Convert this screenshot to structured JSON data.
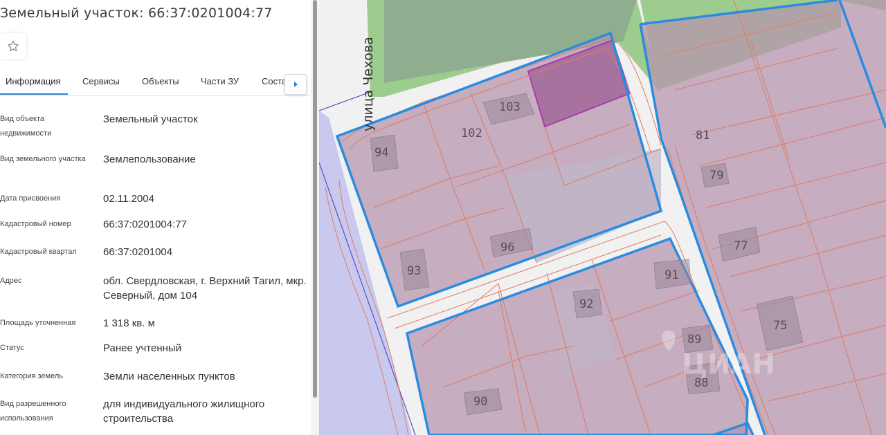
{
  "panel": {
    "title": "Земельный участок: 66:37:0201004:77",
    "tabs": [
      "Информация",
      "Сервисы",
      "Объекты",
      "Части ЗУ",
      "Соста"
    ],
    "active_tab": "Информация",
    "fields": [
      {
        "label": "Вид объекта недвижимости",
        "value": "Земельный участок"
      },
      {
        "label": "Вид земельного участка",
        "value": "Землепользование"
      },
      {
        "label": "Дата присвоения",
        "value": "02.11.2004"
      },
      {
        "label": "Кадастровый номер",
        "value": "66:37:0201004:77"
      },
      {
        "label": "Кадастровый квартал",
        "value": "66:37:0201004"
      },
      {
        "label": "Адрес",
        "value": "обл. Свердловская, г. Верхний Тагил, мкр. Северный, дом 104"
      },
      {
        "label": "Площадь уточненная",
        "value": "1 318 кв. м"
      },
      {
        "label": "Статус",
        "value": "Ранее учтенный"
      },
      {
        "label": "Категория земель",
        "value": "Земли населенных пунктов"
      },
      {
        "label": "Вид разрешенного использования",
        "value": "для индивидуального жилищного строительства"
      }
    ]
  },
  "map": {
    "street_label": "улица Чехова",
    "parcel_numbers": [
      "103",
      "102",
      "94",
      "96",
      "93",
      "81",
      "79",
      "77",
      "75",
      "91",
      "92",
      "89",
      "88",
      "90"
    ],
    "watermark": "ЦИАН",
    "colors": {
      "parcel_fill": "#b795ae",
      "block_border": "#2a8be0",
      "parcel_line": "#e07a60",
      "selected_parcel": "#a53bb0",
      "green": "#9ccc8e",
      "road": "#f1f1f1",
      "water": "#c9c9ef"
    }
  }
}
